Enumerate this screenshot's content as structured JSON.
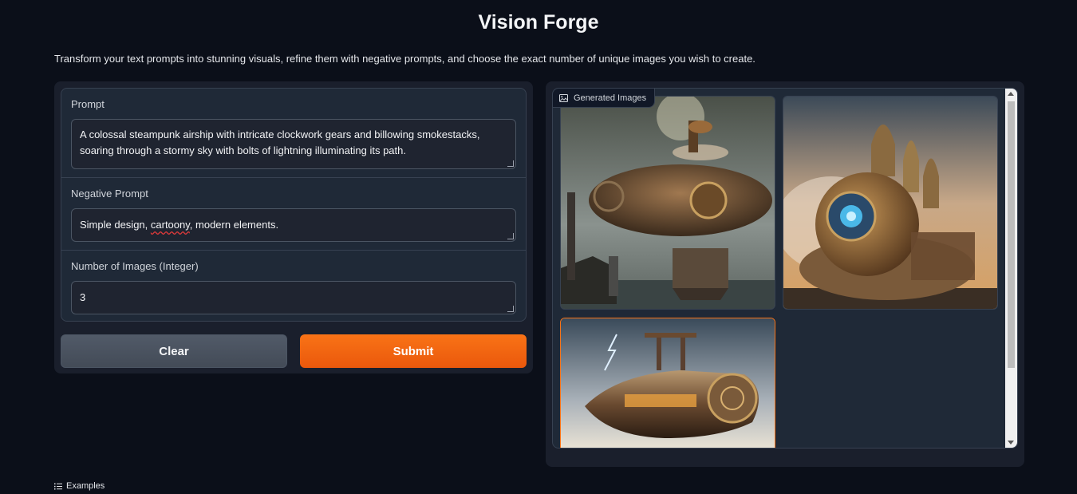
{
  "header": {
    "title": "Vision Forge",
    "description": "Transform your text prompts into stunning visuals, refine them with negative prompts, and choose the exact number of unique images you wish to create."
  },
  "form": {
    "prompt_label": "Prompt",
    "prompt_value_line1": "A colossal steampunk airship with intricate clockwork gears and billowing smokestacks,",
    "prompt_value_line2": "soaring through a stormy sky with bolts of lightning illuminating its path.",
    "negative_label": "Negative Prompt",
    "negative_value_before": "Simple design, ",
    "negative_value_misspelled": "cartoony",
    "negative_value_after": ", modern elements.",
    "count_label": "Number of Images (Integer)",
    "count_value": "3"
  },
  "buttons": {
    "clear_label": "Clear",
    "submit_label": "Submit"
  },
  "gallery": {
    "tag_label": "Generated Images",
    "icon": "image-icon",
    "image_count": 3,
    "selected_index": 2
  },
  "footer": {
    "examples_label": "Examples",
    "icon": "list-icon"
  },
  "colors": {
    "background": "#0b0f19",
    "panel": "#1a1f2c",
    "accent": "#f97316"
  }
}
